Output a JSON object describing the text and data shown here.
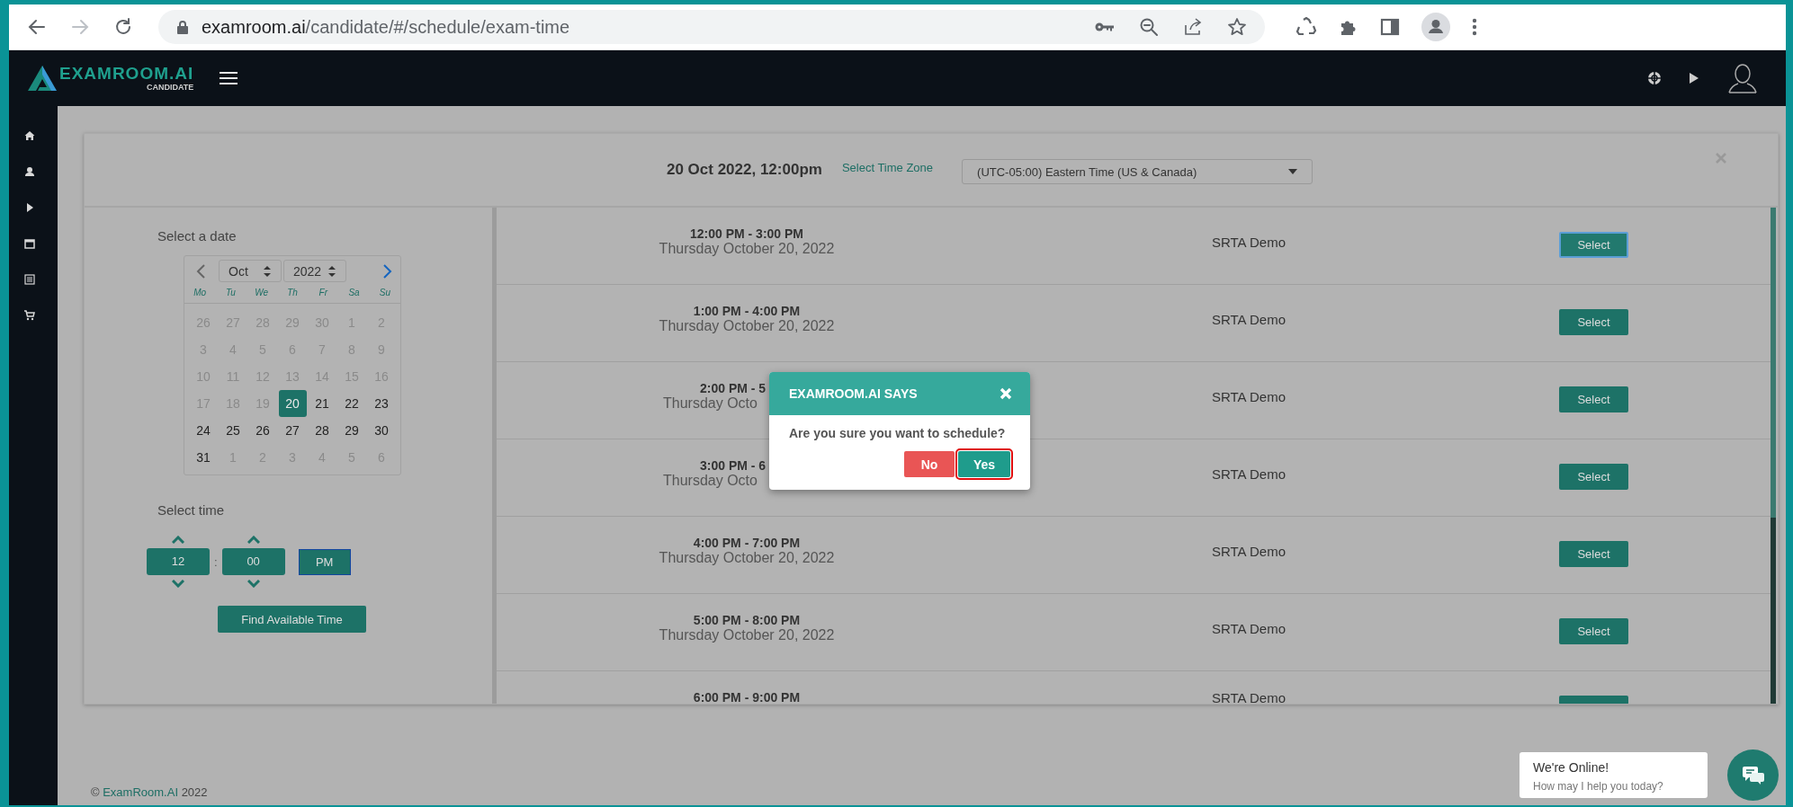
{
  "browser": {
    "url_host": "examroom.ai",
    "url_path": "/candidate/#/schedule/exam-time"
  },
  "app_header": {
    "logo_name": "EXAMROOM.AI",
    "logo_subtitle": "CANDIDATE"
  },
  "scheduler": {
    "heading": "20 Oct 2022, 12:00pm",
    "timezone_label": "Select Time Zone",
    "timezone_value": "(UTC-05:00) Eastern Time (US & Canada)",
    "date_label": "Select a date",
    "month": "Oct",
    "year": "2022",
    "weekdays": [
      "Mo",
      "Tu",
      "We",
      "Th",
      "Fr",
      "Sa",
      "Su"
    ],
    "days": [
      {
        "day": "26",
        "disabled": true,
        "selected": false
      },
      {
        "day": "27",
        "disabled": true,
        "selected": false
      },
      {
        "day": "28",
        "disabled": true,
        "selected": false
      },
      {
        "day": "29",
        "disabled": true,
        "selected": false
      },
      {
        "day": "30",
        "disabled": true,
        "selected": false
      },
      {
        "day": "1",
        "disabled": true,
        "selected": false
      },
      {
        "day": "2",
        "disabled": true,
        "selected": false
      },
      {
        "day": "3",
        "disabled": true,
        "selected": false
      },
      {
        "day": "4",
        "disabled": true,
        "selected": false
      },
      {
        "day": "5",
        "disabled": true,
        "selected": false
      },
      {
        "day": "6",
        "disabled": true,
        "selected": false
      },
      {
        "day": "7",
        "disabled": true,
        "selected": false
      },
      {
        "day": "8",
        "disabled": true,
        "selected": false
      },
      {
        "day": "9",
        "disabled": true,
        "selected": false
      },
      {
        "day": "10",
        "disabled": true,
        "selected": false
      },
      {
        "day": "11",
        "disabled": true,
        "selected": false
      },
      {
        "day": "12",
        "disabled": true,
        "selected": false
      },
      {
        "day": "13",
        "disabled": true,
        "selected": false
      },
      {
        "day": "14",
        "disabled": true,
        "selected": false
      },
      {
        "day": "15",
        "disabled": true,
        "selected": false
      },
      {
        "day": "16",
        "disabled": true,
        "selected": false
      },
      {
        "day": "17",
        "disabled": true,
        "selected": false
      },
      {
        "day": "18",
        "disabled": true,
        "selected": false
      },
      {
        "day": "19",
        "disabled": true,
        "selected": false
      },
      {
        "day": "20",
        "disabled": false,
        "selected": true
      },
      {
        "day": "21",
        "disabled": false,
        "selected": false
      },
      {
        "day": "22",
        "disabled": false,
        "selected": false
      },
      {
        "day": "23",
        "disabled": false,
        "selected": false
      },
      {
        "day": "24",
        "disabled": false,
        "selected": false
      },
      {
        "day": "25",
        "disabled": false,
        "selected": false
      },
      {
        "day": "26",
        "disabled": false,
        "selected": false
      },
      {
        "day": "27",
        "disabled": false,
        "selected": false
      },
      {
        "day": "28",
        "disabled": false,
        "selected": false
      },
      {
        "day": "29",
        "disabled": false,
        "selected": false
      },
      {
        "day": "30",
        "disabled": false,
        "selected": false
      },
      {
        "day": "31",
        "disabled": false,
        "selected": false
      },
      {
        "day": "1",
        "disabled": true,
        "selected": false
      },
      {
        "day": "2",
        "disabled": true,
        "selected": false
      },
      {
        "day": "3",
        "disabled": true,
        "selected": false
      },
      {
        "day": "4",
        "disabled": true,
        "selected": false
      },
      {
        "day": "5",
        "disabled": true,
        "selected": false
      },
      {
        "day": "6",
        "disabled": true,
        "selected": false
      }
    ],
    "time_label": "Select time",
    "hour": "12",
    "separator": ":",
    "minute": "00",
    "meridiem": "PM",
    "find_button": "Find Available Time",
    "slots": [
      {
        "time": "12:00 PM - 3:00 PM",
        "date": "Thursday October 20, 2022",
        "exam": "SRTA Demo",
        "button": "Select",
        "focused": true
      },
      {
        "time": "1:00 PM - 4:00 PM",
        "date": "Thursday October 20, 2022",
        "exam": "SRTA Demo",
        "button": "Select",
        "focused": false
      },
      {
        "time": "2:00 PM - 5",
        "date": "Thursday Octo",
        "exam": "SRTA Demo",
        "button": "Select",
        "focused": false
      },
      {
        "time": "3:00 PM - 6",
        "date": "Thursday Octo",
        "exam": "SRTA Demo",
        "button": "Select",
        "focused": false
      },
      {
        "time": "4:00 PM - 7:00 PM",
        "date": "Thursday October 20, 2022",
        "exam": "SRTA Demo",
        "button": "Select",
        "focused": false
      },
      {
        "time": "5:00 PM - 8:00 PM",
        "date": "Thursday October 20, 2022",
        "exam": "SRTA Demo",
        "button": "Select",
        "focused": false
      },
      {
        "time": "6:00 PM - 9:00 PM",
        "exam": "SRTA Demo",
        "focused": false
      }
    ]
  },
  "dialog": {
    "title": "EXAMROOM.AI SAYS",
    "message": "Are you sure you want to schedule?",
    "buttons": [
      {
        "label": "No",
        "kind": "danger",
        "focused": false
      },
      {
        "label": "Yes",
        "kind": "primary",
        "focused": true
      }
    ]
  },
  "footer": {
    "prefix": "©",
    "link": "ExamRoom.AI",
    "suffix": "2022"
  },
  "chat": {
    "title": "We're Online!",
    "subtitle": "How may I help you today?"
  }
}
